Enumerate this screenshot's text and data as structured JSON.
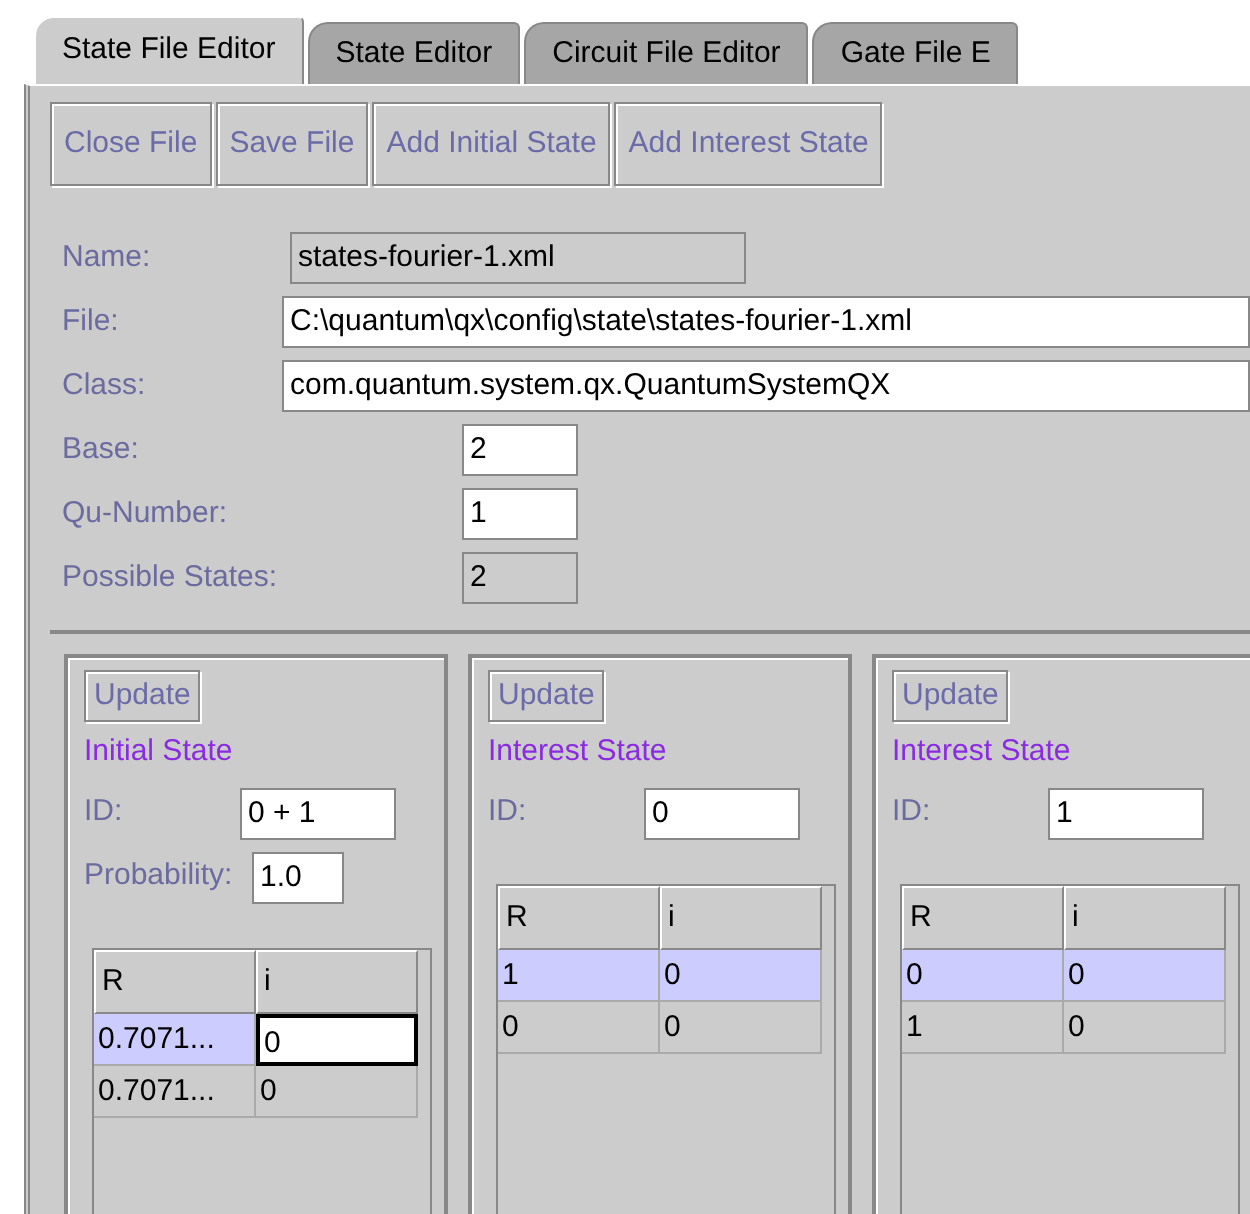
{
  "tabs": [
    {
      "label": "State File Editor",
      "selected": true
    },
    {
      "label": "State Editor",
      "selected": false
    },
    {
      "label": "Circuit File Editor",
      "selected": false
    },
    {
      "label": "Gate File E",
      "selected": false
    }
  ],
  "toolbar": [
    "Close File",
    "Save File",
    "Add Initial State",
    "Add Interest State"
  ],
  "fields": [
    {
      "label": "Name:",
      "value": "states-fourier-1.xml",
      "kind": "wide",
      "editable": false
    },
    {
      "label": "File:",
      "value": "C:\\quantum\\qx\\config\\state\\states-fourier-1.xml",
      "kind": "full",
      "editable": true
    },
    {
      "label": "Class:",
      "value": "com.quantum.system.qx.QuantumSystemQX",
      "kind": "full",
      "editable": true
    },
    {
      "label": "Base:",
      "value": "2",
      "kind": "short",
      "editable": true
    },
    {
      "label": "Qu-Number:",
      "value": "1",
      "kind": "short",
      "editable": true
    },
    {
      "label": "Possible States:",
      "value": "2",
      "kind": "short",
      "editable": false
    }
  ],
  "states": [
    {
      "button": "Update",
      "title": "Initial State",
      "id_label": "ID:",
      "id": "0 + 1",
      "probability_label": "Probability:",
      "probability": "1.0",
      "columns": [
        "R",
        "i"
      ],
      "rows": [
        {
          "selected": true,
          "cells": [
            {
              "text": "0.7071...",
              "editing": false
            },
            {
              "text": "0",
              "editing": true
            }
          ]
        },
        {
          "selected": false,
          "cells": [
            {
              "text": "0.7071...",
              "editing": false
            },
            {
              "text": "0",
              "editing": false
            }
          ]
        }
      ]
    },
    {
      "button": "Update",
      "title": "Interest State",
      "id_label": "ID:",
      "id": "0",
      "columns": [
        "R",
        "i"
      ],
      "rows": [
        {
          "selected": true,
          "cells": [
            {
              "text": "1",
              "editing": false
            },
            {
              "text": "0",
              "editing": false
            }
          ]
        },
        {
          "selected": false,
          "cells": [
            {
              "text": "0",
              "editing": false
            },
            {
              "text": "0",
              "editing": false
            }
          ]
        }
      ]
    },
    {
      "button": "Update",
      "title": "Interest State",
      "id_label": "ID:",
      "id": "1",
      "columns": [
        "R",
        "i"
      ],
      "rows": [
        {
          "selected": true,
          "cells": [
            {
              "text": "0",
              "editing": false
            },
            {
              "text": "0",
              "editing": false
            }
          ]
        },
        {
          "selected": false,
          "cells": [
            {
              "text": "1",
              "editing": false
            },
            {
              "text": "0",
              "editing": false
            }
          ]
        }
      ]
    }
  ]
}
